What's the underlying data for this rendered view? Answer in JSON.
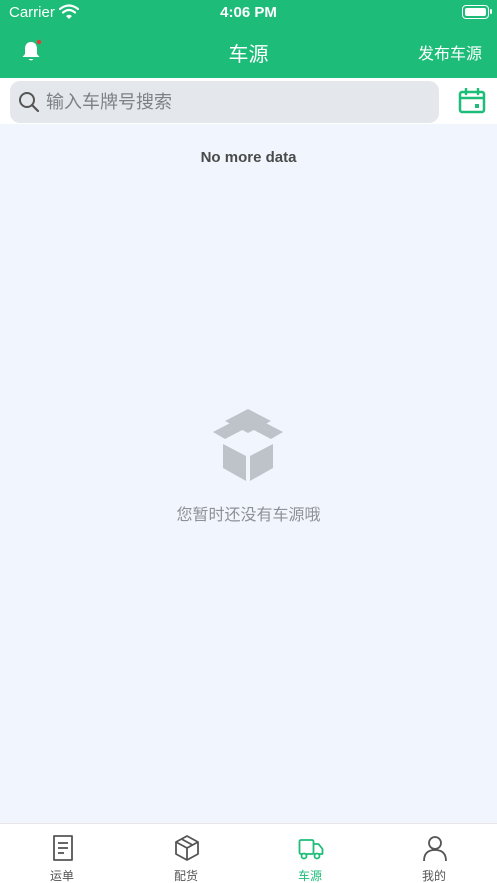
{
  "status_bar": {
    "carrier": "Carrier",
    "time": "4:06 PM"
  },
  "nav": {
    "title": "车源",
    "right_action": "发布车源"
  },
  "search": {
    "placeholder": "输入车牌号搜索",
    "value": ""
  },
  "list": {
    "footer_text": "No more data"
  },
  "empty_state": {
    "message": "您暂时还没有车源哦"
  },
  "tabbar": {
    "items": [
      {
        "label": "运单",
        "icon": "waybill-icon",
        "active": false
      },
      {
        "label": "配货",
        "icon": "box-icon",
        "active": false
      },
      {
        "label": "车源",
        "icon": "truck-icon",
        "active": true
      },
      {
        "label": "我的",
        "icon": "profile-icon",
        "active": false
      }
    ]
  },
  "colors": {
    "brand": "#1dbd79",
    "background": "#f1f6fe",
    "notification_dot": "#e53935"
  }
}
